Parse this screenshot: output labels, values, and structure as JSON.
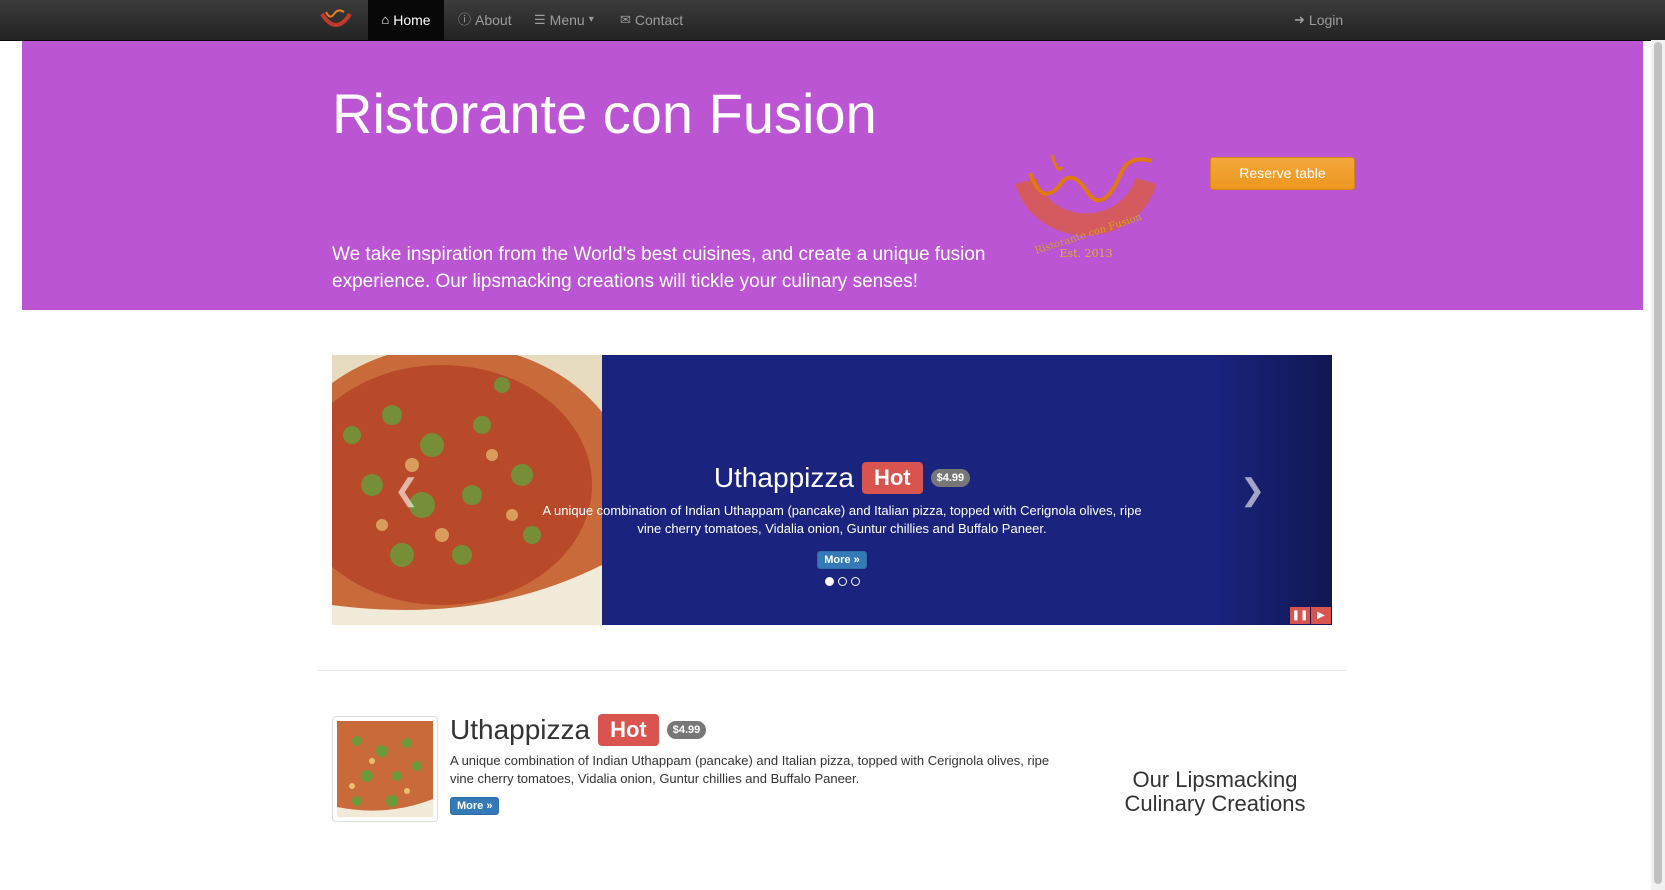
{
  "nav": {
    "brand_icon": "restaurant-logo",
    "items": [
      {
        "label": "Home",
        "icon": "home-icon",
        "active": true
      },
      {
        "label": "About",
        "icon": "info-icon",
        "active": false
      },
      {
        "label": "Menu",
        "icon": "list-icon",
        "active": false,
        "caret": "▾"
      },
      {
        "label": "Contact",
        "icon": "envelope-icon",
        "active": false
      }
    ],
    "login": {
      "label": "Login",
      "icon": "login-icon"
    }
  },
  "jumbotron": {
    "title": "Ristorante con Fusion",
    "description": "We take inspiration from the World's best cuisines, and create a unique fusion experience. Our lipsmacking creations will tickle your culinary senses!",
    "logo_text": "Ristorante con Fusion",
    "logo_est": "Est. 2013",
    "reserve_label": "Reserve table",
    "background": "#bb55d4"
  },
  "carousel": {
    "title": "Uthappizza",
    "badge": "Hot",
    "price": "$4.99",
    "description": "A unique combination of Indian Uthappam (pancake) and Italian pizza, topped with Cerignola olives, ripe vine cherry tomatoes, Vidalia onion, Guntur chillies and Buffalo Paneer.",
    "more_label": "More »",
    "slides": 3,
    "active_slide": 1,
    "prev_icon": "chevron-left-icon",
    "next_icon": "chevron-right-icon",
    "pause_icon": "pause-icon",
    "play_icon": "play-icon",
    "background": "#1a237e"
  },
  "media": {
    "title": "Uthappizza",
    "badge": "Hot",
    "price": "$4.99",
    "description": "A unique combination of Indian Uthappam (pancake) and Italian pizza, topped with Cerignola olives, ripe vine cherry tomatoes, Vidalia onion, Guntur chillies and Buffalo Paneer.",
    "more_label": "More »"
  },
  "side": {
    "line1": "Our Lipsmacking",
    "line2": "Culinary Creations"
  }
}
